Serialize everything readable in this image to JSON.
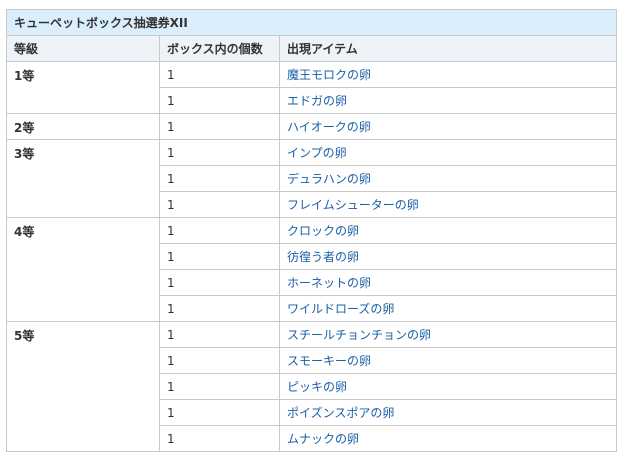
{
  "table": {
    "title": "キューペットボックス抽選券XII",
    "headers": [
      "等級",
      "ボックス内の個数",
      "出現アイテム"
    ],
    "groups": [
      {
        "rank": "1等",
        "items": [
          {
            "count": "1",
            "name": "魔王モロクの卵"
          },
          {
            "count": "1",
            "name": "エドガの卵"
          }
        ]
      },
      {
        "rank": "2等",
        "items": [
          {
            "count": "1",
            "name": "ハイオークの卵"
          }
        ]
      },
      {
        "rank": "3等",
        "items": [
          {
            "count": "1",
            "name": "インプの卵"
          },
          {
            "count": "1",
            "name": "デュラハンの卵"
          },
          {
            "count": "1",
            "name": "フレイムシューターの卵"
          }
        ]
      },
      {
        "rank": "4等",
        "items": [
          {
            "count": "1",
            "name": "クロックの卵"
          },
          {
            "count": "1",
            "name": "彷徨う者の卵"
          },
          {
            "count": "1",
            "name": "ホーネットの卵"
          },
          {
            "count": "1",
            "name": "ワイルドローズの卵"
          }
        ]
      },
      {
        "rank": "5等",
        "items": [
          {
            "count": "1",
            "name": "スチールチョンチョンの卵"
          },
          {
            "count": "1",
            "name": "スモーキーの卵"
          },
          {
            "count": "1",
            "name": "ピッキの卵"
          },
          {
            "count": "1",
            "name": "ポイズンスポアの卵"
          },
          {
            "count": "1",
            "name": "ムナックの卵"
          }
        ]
      }
    ]
  }
}
